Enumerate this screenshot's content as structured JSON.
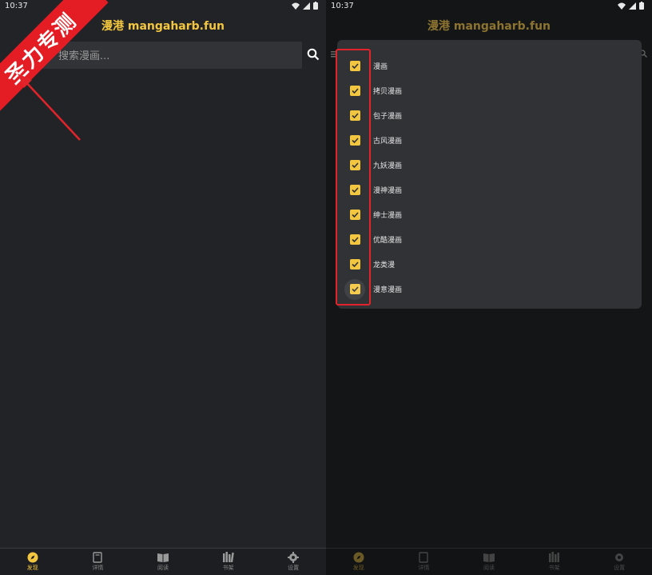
{
  "left": {
    "status": {
      "time": "10:37"
    },
    "app_title": "漫港 mangaharb.fun",
    "search": {
      "placeholder": "搜索漫画..."
    },
    "nav": [
      {
        "label": "发现",
        "icon": "compass-icon",
        "active": true
      },
      {
        "label": "详情",
        "icon": "book-icon",
        "active": false
      },
      {
        "label": "阅读",
        "icon": "open-book-icon",
        "active": false
      },
      {
        "label": "书架",
        "icon": "bookshelf-icon",
        "active": false
      },
      {
        "label": "设置",
        "icon": "gear-icon",
        "active": false
      }
    ]
  },
  "right": {
    "status": {
      "time": "10:37"
    },
    "app_title": "漫港 mangaharb.fun",
    "dialog": {
      "options": [
        {
          "label": "漫画",
          "checked": true
        },
        {
          "label": "拷贝漫画",
          "checked": true
        },
        {
          "label": "包子漫画",
          "checked": true
        },
        {
          "label": "古风漫画",
          "checked": true
        },
        {
          "label": "九妖漫画",
          "checked": true
        },
        {
          "label": "漫神漫画",
          "checked": true
        },
        {
          "label": "绅士漫画",
          "checked": true
        },
        {
          "label": "优酷漫画",
          "checked": true
        },
        {
          "label": "龙类漫",
          "checked": true
        },
        {
          "label": "漫意漫画",
          "checked": true
        }
      ]
    },
    "nav": [
      {
        "label": "发现",
        "icon": "compass-icon",
        "active": true
      },
      {
        "label": "详情",
        "icon": "book-icon",
        "active": false
      },
      {
        "label": "阅读",
        "icon": "open-book-icon",
        "active": false
      },
      {
        "label": "书架",
        "icon": "bookshelf-icon",
        "active": false
      },
      {
        "label": "设置",
        "icon": "gear-icon",
        "active": false
      }
    ]
  },
  "watermark": {
    "text": "圣力专测"
  },
  "colors": {
    "accent": "#f3c640",
    "highlight": "#e2242a",
    "background": "#222326"
  }
}
